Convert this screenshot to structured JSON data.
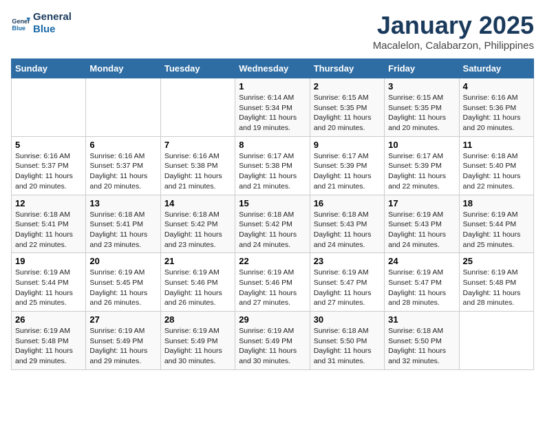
{
  "logo": {
    "line1": "General",
    "line2": "Blue"
  },
  "title": "January 2025",
  "subtitle": "Macalelon, Calabarzon, Philippines",
  "days_of_week": [
    "Sunday",
    "Monday",
    "Tuesday",
    "Wednesday",
    "Thursday",
    "Friday",
    "Saturday"
  ],
  "weeks": [
    [
      {
        "day": "",
        "sunrise": "",
        "sunset": "",
        "daylight": ""
      },
      {
        "day": "",
        "sunrise": "",
        "sunset": "",
        "daylight": ""
      },
      {
        "day": "",
        "sunrise": "",
        "sunset": "",
        "daylight": ""
      },
      {
        "day": "1",
        "sunrise": "6:14 AM",
        "sunset": "5:34 PM",
        "daylight": "11 hours and 19 minutes."
      },
      {
        "day": "2",
        "sunrise": "6:15 AM",
        "sunset": "5:35 PM",
        "daylight": "11 hours and 20 minutes."
      },
      {
        "day": "3",
        "sunrise": "6:15 AM",
        "sunset": "5:35 PM",
        "daylight": "11 hours and 20 minutes."
      },
      {
        "day": "4",
        "sunrise": "6:16 AM",
        "sunset": "5:36 PM",
        "daylight": "11 hours and 20 minutes."
      }
    ],
    [
      {
        "day": "5",
        "sunrise": "6:16 AM",
        "sunset": "5:37 PM",
        "daylight": "11 hours and 20 minutes."
      },
      {
        "day": "6",
        "sunrise": "6:16 AM",
        "sunset": "5:37 PM",
        "daylight": "11 hours and 20 minutes."
      },
      {
        "day": "7",
        "sunrise": "6:16 AM",
        "sunset": "5:38 PM",
        "daylight": "11 hours and 21 minutes."
      },
      {
        "day": "8",
        "sunrise": "6:17 AM",
        "sunset": "5:38 PM",
        "daylight": "11 hours and 21 minutes."
      },
      {
        "day": "9",
        "sunrise": "6:17 AM",
        "sunset": "5:39 PM",
        "daylight": "11 hours and 21 minutes."
      },
      {
        "day": "10",
        "sunrise": "6:17 AM",
        "sunset": "5:39 PM",
        "daylight": "11 hours and 22 minutes."
      },
      {
        "day": "11",
        "sunrise": "6:18 AM",
        "sunset": "5:40 PM",
        "daylight": "11 hours and 22 minutes."
      }
    ],
    [
      {
        "day": "12",
        "sunrise": "6:18 AM",
        "sunset": "5:41 PM",
        "daylight": "11 hours and 22 minutes."
      },
      {
        "day": "13",
        "sunrise": "6:18 AM",
        "sunset": "5:41 PM",
        "daylight": "11 hours and 23 minutes."
      },
      {
        "day": "14",
        "sunrise": "6:18 AM",
        "sunset": "5:42 PM",
        "daylight": "11 hours and 23 minutes."
      },
      {
        "day": "15",
        "sunrise": "6:18 AM",
        "sunset": "5:42 PM",
        "daylight": "11 hours and 24 minutes."
      },
      {
        "day": "16",
        "sunrise": "6:18 AM",
        "sunset": "5:43 PM",
        "daylight": "11 hours and 24 minutes."
      },
      {
        "day": "17",
        "sunrise": "6:19 AM",
        "sunset": "5:43 PM",
        "daylight": "11 hours and 24 minutes."
      },
      {
        "day": "18",
        "sunrise": "6:19 AM",
        "sunset": "5:44 PM",
        "daylight": "11 hours and 25 minutes."
      }
    ],
    [
      {
        "day": "19",
        "sunrise": "6:19 AM",
        "sunset": "5:44 PM",
        "daylight": "11 hours and 25 minutes."
      },
      {
        "day": "20",
        "sunrise": "6:19 AM",
        "sunset": "5:45 PM",
        "daylight": "11 hours and 26 minutes."
      },
      {
        "day": "21",
        "sunrise": "6:19 AM",
        "sunset": "5:46 PM",
        "daylight": "11 hours and 26 minutes."
      },
      {
        "day": "22",
        "sunrise": "6:19 AM",
        "sunset": "5:46 PM",
        "daylight": "11 hours and 27 minutes."
      },
      {
        "day": "23",
        "sunrise": "6:19 AM",
        "sunset": "5:47 PM",
        "daylight": "11 hours and 27 minutes."
      },
      {
        "day": "24",
        "sunrise": "6:19 AM",
        "sunset": "5:47 PM",
        "daylight": "11 hours and 28 minutes."
      },
      {
        "day": "25",
        "sunrise": "6:19 AM",
        "sunset": "5:48 PM",
        "daylight": "11 hours and 28 minutes."
      }
    ],
    [
      {
        "day": "26",
        "sunrise": "6:19 AM",
        "sunset": "5:48 PM",
        "daylight": "11 hours and 29 minutes."
      },
      {
        "day": "27",
        "sunrise": "6:19 AM",
        "sunset": "5:49 PM",
        "daylight": "11 hours and 29 minutes."
      },
      {
        "day": "28",
        "sunrise": "6:19 AM",
        "sunset": "5:49 PM",
        "daylight": "11 hours and 30 minutes."
      },
      {
        "day": "29",
        "sunrise": "6:19 AM",
        "sunset": "5:49 PM",
        "daylight": "11 hours and 30 minutes."
      },
      {
        "day": "30",
        "sunrise": "6:18 AM",
        "sunset": "5:50 PM",
        "daylight": "11 hours and 31 minutes."
      },
      {
        "day": "31",
        "sunrise": "6:18 AM",
        "sunset": "5:50 PM",
        "daylight": "11 hours and 32 minutes."
      },
      {
        "day": "",
        "sunrise": "",
        "sunset": "",
        "daylight": ""
      }
    ]
  ]
}
